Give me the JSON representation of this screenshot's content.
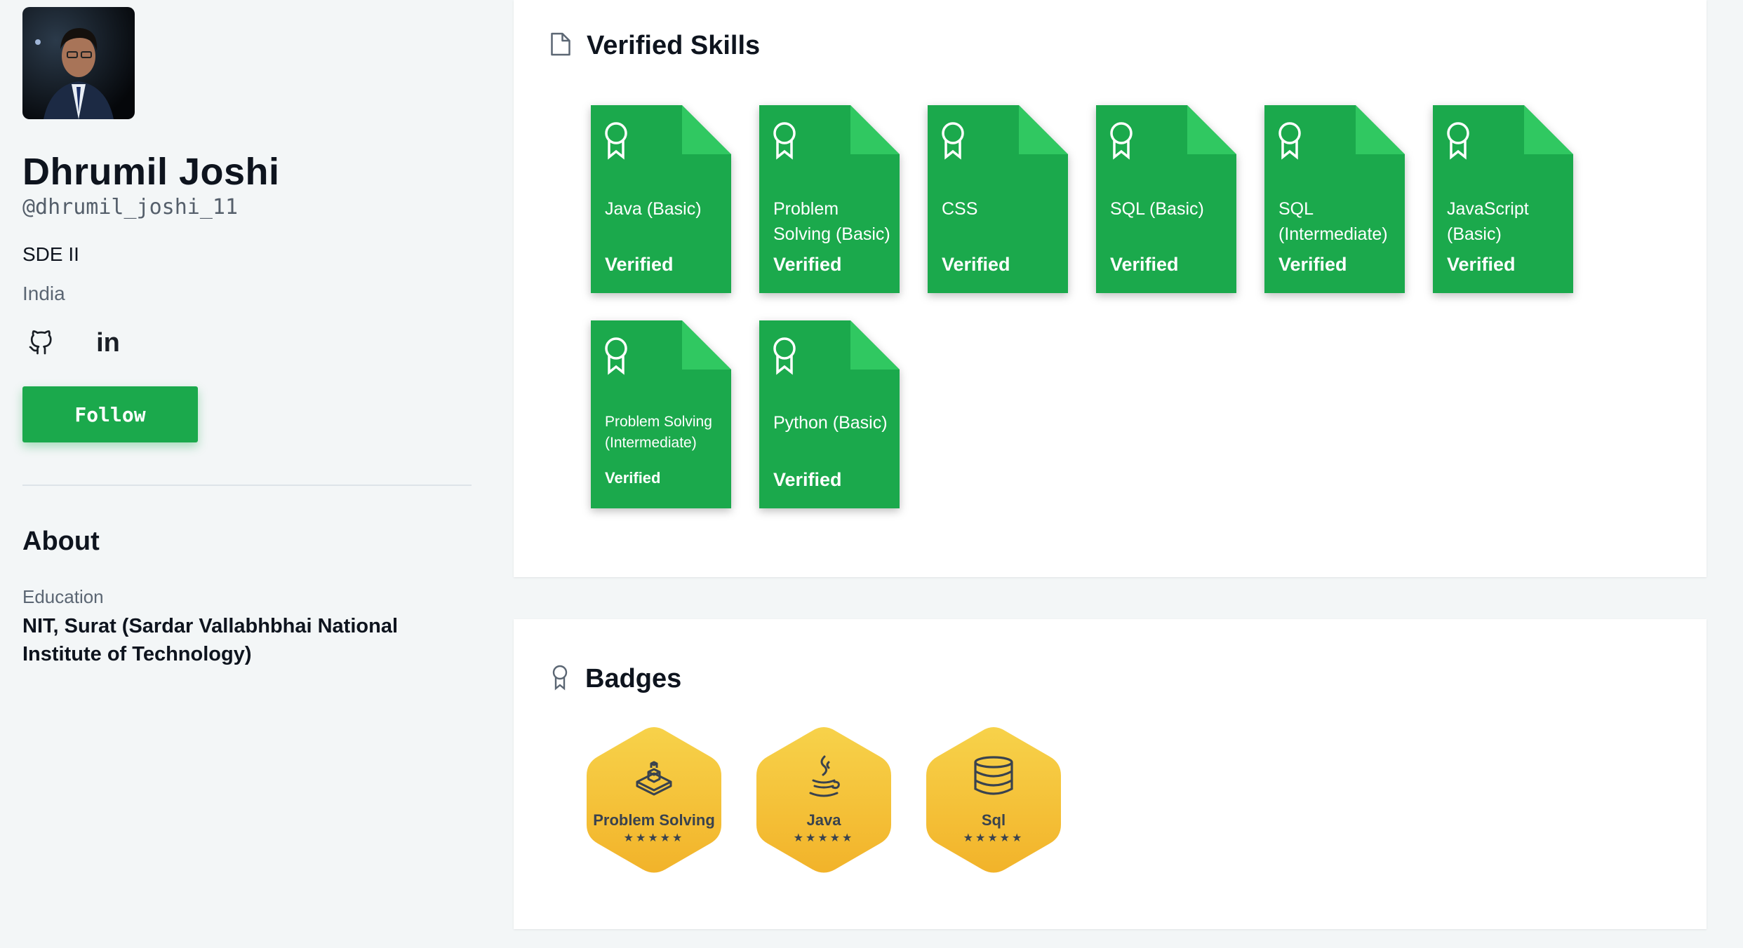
{
  "profile": {
    "name": "Dhrumil Joshi",
    "handle": "@dhrumil_joshi_11",
    "role": "SDE II",
    "location": "India",
    "follow_label": "Follow",
    "linkedin_label": "in"
  },
  "about": {
    "title": "About",
    "education_label": "Education",
    "education_value": "NIT, Surat (Sardar Vallabhbhai National Institute of Technology)"
  },
  "skills": {
    "title": "Verified Skills",
    "accent": "#1ba94c",
    "items": [
      {
        "name": "Java (Basic)",
        "status": "Verified"
      },
      {
        "name": "Problem Solving (Basic)",
        "status": "Verified"
      },
      {
        "name": "CSS",
        "status": "Verified"
      },
      {
        "name": "SQL (Basic)",
        "status": "Verified"
      },
      {
        "name": "SQL (Intermediate)",
        "status": "Verified"
      },
      {
        "name": "JavaScript (Basic)",
        "status": "Verified"
      },
      {
        "name": "Problem Solving (Intermediate)",
        "status": "Verified"
      },
      {
        "name": "Python (Basic)",
        "status": "Verified"
      }
    ]
  },
  "badges": {
    "title": "Badges",
    "accent": "#f5c12e",
    "items": [
      {
        "name": "Problem Solving",
        "stars": "★★★★★",
        "icon": "problem-solving-icon"
      },
      {
        "name": "Java",
        "stars": "★★★★★",
        "icon": "java-cup-icon"
      },
      {
        "name": "Sql",
        "stars": "★★★★★",
        "icon": "database-icon"
      }
    ]
  }
}
